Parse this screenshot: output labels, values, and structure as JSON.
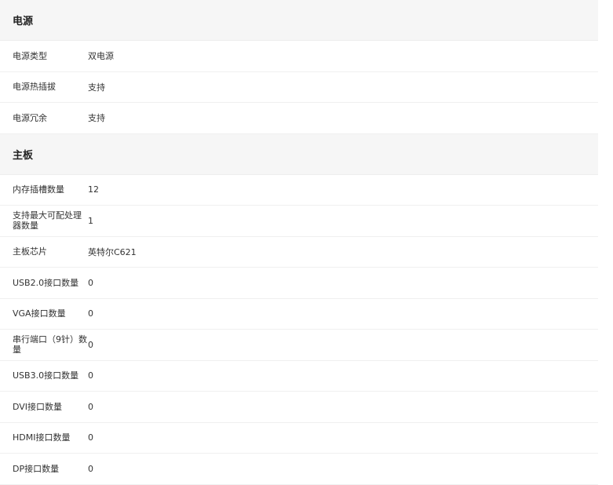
{
  "sections": [
    {
      "title": "电源",
      "rows": [
        {
          "label": "电源类型",
          "value": "双电源"
        },
        {
          "label": "电源热插拔",
          "value": "支持"
        },
        {
          "label": "电源冗余",
          "value": "支持"
        }
      ]
    },
    {
      "title": "主板",
      "rows": [
        {
          "label": "内存插槽数量",
          "value": "12"
        },
        {
          "label": "支持最大可配处理器数量",
          "value": "1"
        },
        {
          "label": "主板芯片",
          "value": "英特尔C621"
        },
        {
          "label": "USB2.0接口数量",
          "value": "0"
        },
        {
          "label": "VGA接口数量",
          "value": "0"
        },
        {
          "label": "串行端口（9针）数量",
          "value": "0"
        },
        {
          "label": "USB3.0接口数量",
          "value": "0"
        },
        {
          "label": "DVI接口数量",
          "value": "0"
        },
        {
          "label": "HDMI接口数量",
          "value": "0"
        },
        {
          "label": "DP接口数量",
          "value": "0"
        }
      ]
    }
  ]
}
